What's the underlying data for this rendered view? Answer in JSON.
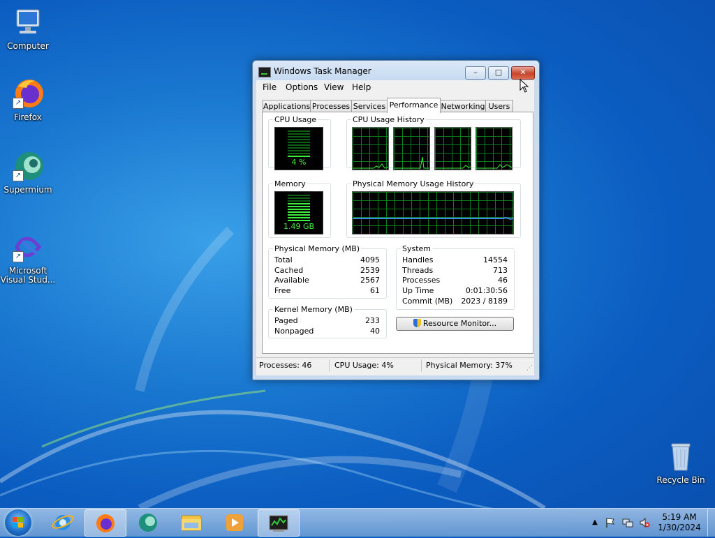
{
  "desktop": {
    "icons": [
      {
        "label": "Computer",
        "icon": "computer-icon"
      },
      {
        "label": "Firefox",
        "icon": "firefox-icon"
      },
      {
        "label": "Supermium",
        "icon": "supermium-icon"
      },
      {
        "label": "Microsoft Visual Stud...",
        "icon": "visual-studio-icon"
      },
      {
        "label": "Recycle Bin",
        "icon": "recycle-bin-icon"
      }
    ]
  },
  "window": {
    "title": "Windows Task Manager",
    "controls": {
      "minimize": "–",
      "maximize": "□",
      "close": "✕"
    },
    "menu": [
      "File",
      "Options",
      "View",
      "Help"
    ],
    "tabs": [
      "Applications",
      "Processes",
      "Services",
      "Performance",
      "Networking",
      "Users"
    ],
    "active_tab": "Performance",
    "performance": {
      "cpu_usage": {
        "label": "CPU Usage",
        "value": "4 %",
        "percent": 4
      },
      "cpu_history": {
        "label": "CPU Usage History",
        "cores": 4
      },
      "memory": {
        "label": "Memory",
        "value": "1.49 GB",
        "percent": 37
      },
      "memory_history": {
        "label": "Physical Memory Usage History"
      },
      "physical_memory": {
        "label": "Physical Memory (MB)",
        "rows": [
          {
            "name": "Total",
            "value": "4095"
          },
          {
            "name": "Cached",
            "value": "2539"
          },
          {
            "name": "Available",
            "value": "2567"
          },
          {
            "name": "Free",
            "value": "61"
          }
        ]
      },
      "kernel_memory": {
        "label": "Kernel Memory (MB)",
        "rows": [
          {
            "name": "Paged",
            "value": "233"
          },
          {
            "name": "Nonpaged",
            "value": "40"
          }
        ]
      },
      "system": {
        "label": "System",
        "rows": [
          {
            "name": "Handles",
            "value": "14554"
          },
          {
            "name": "Threads",
            "value": "713"
          },
          {
            "name": "Processes",
            "value": "46"
          },
          {
            "name": "Up Time",
            "value": "0:01:30:56"
          },
          {
            "name": "Commit (MB)",
            "value": "2023 / 8189"
          }
        ]
      },
      "resource_monitor_button": "Resource Monitor..."
    },
    "status": {
      "processes": "Processes: 46",
      "cpu": "CPU Usage: 4%",
      "memory": "Physical Memory: 37%"
    }
  },
  "taskbar": {
    "pinned": [
      "internet-explorer-icon",
      "firefox-icon",
      "supermium-icon",
      "file-explorer-icon",
      "media-player-icon",
      "task-manager-icon"
    ],
    "time": "5:19 AM",
    "date": "1/30/2024"
  },
  "colors": {
    "meter_green": "#3ef03e",
    "memory_line": "#3a8ee8",
    "close_red": "#c8442b"
  }
}
